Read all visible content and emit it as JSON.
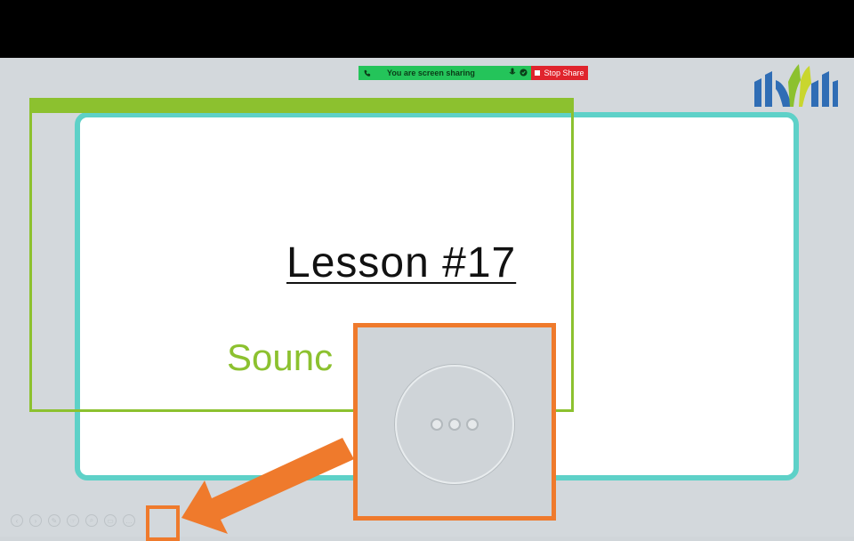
{
  "share_bar": {
    "status_text": "You are screen sharing",
    "stop_label": "Stop Share"
  },
  "slide": {
    "title": "Lesson #17",
    "subtitle": "Sounc          n, Wh"
  },
  "toolbar": {
    "icons": [
      "previous-icon",
      "next-icon",
      "pen-icon",
      "pointer-icon",
      "zoom-icon",
      "slides-icon",
      "more-options-icon"
    ]
  },
  "colors": {
    "accent_green": "#8cc12f",
    "teal": "#5ed1c8",
    "callout_orange": "#ef7a2c",
    "share_green": "#24c45a",
    "stop_red": "#e0242d"
  }
}
